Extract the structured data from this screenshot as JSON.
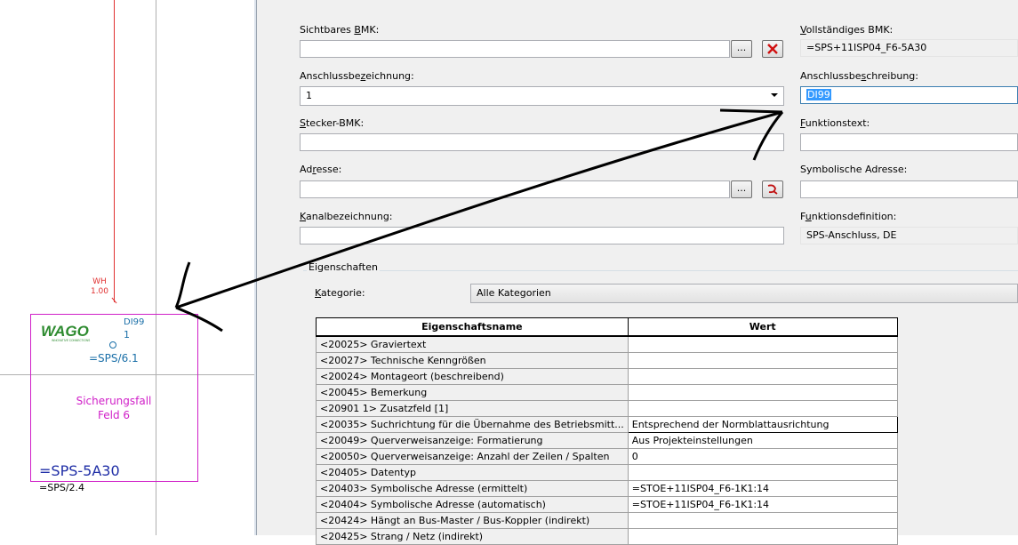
{
  "schematic": {
    "wire_label_color": "WH",
    "wire_label_cross_section": "1.00",
    "device_brand": "WAGO",
    "device_brand_tagline": "INNOVATIVE CONNECTIONS",
    "terminal_function": "DI99",
    "terminal_number": "1",
    "ref_sps_6_1": "=SPS/6.1",
    "function_text_line1": "Sicherungsfall",
    "function_text_line2": "Feld 6",
    "device_tag": "=SPS-5A30",
    "ref_sps_2_4": "=SPS/2.4",
    "colors": {
      "wire": "#e03030",
      "device_box": "#d020c8",
      "tag": "#1f2ea6",
      "terminal": "#1a6fa8"
    }
  },
  "dialog": {
    "fields": {
      "sichtbares_bmk": {
        "label_pre": "Sichtbares ",
        "label_ul": "B",
        "label_post": "MK:",
        "value": "",
        "browse_label": "..."
      },
      "vollstaendiges_bmk": {
        "label_pre": "",
        "label_ul": "V",
        "label_post": "ollständiges BMK:",
        "value": "=SPS+11ISP04_F6-5A30"
      },
      "anschlussbezeichnung": {
        "label_pre": "Anschlussbe",
        "label_ul": "z",
        "label_post": "eichnung:",
        "value": "1"
      },
      "anschlussbeschreibung": {
        "label_pre": "Anschlussbe",
        "label_ul": "s",
        "label_post": "chreibung:",
        "value": "DI99"
      },
      "stecker_bmk": {
        "label_pre": "",
        "label_ul": "S",
        "label_post": "tecker-BMK:",
        "value": ""
      },
      "funktionstext": {
        "label_pre": "",
        "label_ul": "F",
        "label_post": "unktionstext:",
        "value": ""
      },
      "adresse": {
        "label_pre": "Ad",
        "label_ul": "r",
        "label_post": "esse:",
        "value": "",
        "browse_label": "..."
      },
      "symbolische_adresse": {
        "label_pre": "Symbolische Adresse:",
        "label_ul": "",
        "label_post": "",
        "value": ""
      },
      "kanalbezeichnung": {
        "label_pre": "",
        "label_ul": "K",
        "label_post": "analbezeichnung:",
        "value": ""
      },
      "funktionsdefinition": {
        "label_pre": "F",
        "label_ul": "u",
        "label_post": "nktionsdefinition:",
        "value": "SPS-Anschluss, DE"
      }
    },
    "properties_group": "Eigenschaften",
    "category_label_pre": "K",
    "category_label_post": "ategorie:",
    "category_value": "Alle Kategorien",
    "table": {
      "headers": [
        "Eigenschaftsname",
        "Wert"
      ],
      "rows": [
        {
          "name": "<20025> Graviertext",
          "value": ""
        },
        {
          "name": "<20027> Technische Kenngrößen",
          "value": ""
        },
        {
          "name": "<20024> Montageort (beschreibend)",
          "value": ""
        },
        {
          "name": "<20045> Bemerkung",
          "value": ""
        },
        {
          "name": "<20901 1> Zusatzfeld [1]",
          "value": ""
        },
        {
          "name": "<20035> Suchrichtung für die Übernahme des Betriebsmitt...",
          "value": "Entsprechend der Normblattausrichtung"
        },
        {
          "name": "<20049> Querverweisanzeige: Formatierung",
          "value": "Aus Projekteinstellungen"
        },
        {
          "name": "<20050> Querverweisanzeige: Anzahl der Zeilen / Spalten",
          "value": "0"
        },
        {
          "name": "<20405> Datentyp",
          "value": ""
        },
        {
          "name": "<20403> Symbolische Adresse (ermittelt)",
          "value": "=STOE+11ISP04_F6-1K1:14"
        },
        {
          "name": "<20404> Symbolische Adresse (automatisch)",
          "value": "=STOE+11ISP04_F6-1K1:14"
        },
        {
          "name": "<20424> Hängt an Bus-Master / Bus-Koppler (indirekt)",
          "value": ""
        },
        {
          "name": "<20425> Strang / Netz (indirekt)",
          "value": ""
        }
      ]
    },
    "icons": [
      "browse-button",
      "delete-icon",
      "function-icon",
      "dropdown-arrow-icon"
    ]
  }
}
